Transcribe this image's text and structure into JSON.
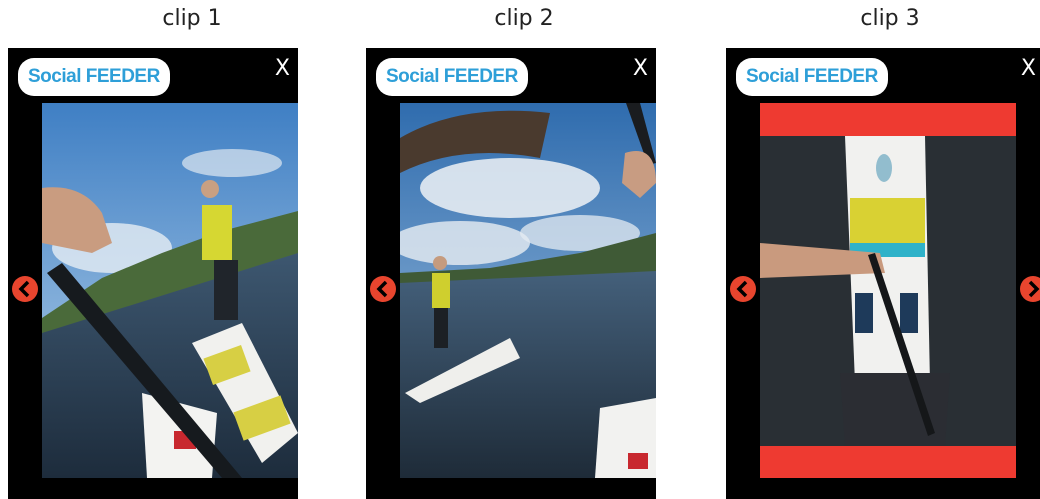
{
  "clips": [
    {
      "title": "clip 1",
      "logo": "Social FEEDER",
      "close": "X"
    },
    {
      "title": "clip 2",
      "logo": "Social FEEDER",
      "close": "X"
    },
    {
      "title": "clip 3",
      "logo": "Social FEEDER",
      "close": "X"
    }
  ],
  "colors": {
    "nav_arrow": "#e8452e",
    "logo_text": "#2e9fd8",
    "letterbox": "#ee3a31"
  },
  "icons": {
    "prev": "chevron-left-icon",
    "next": "chevron-right-icon",
    "close": "close-icon"
  }
}
